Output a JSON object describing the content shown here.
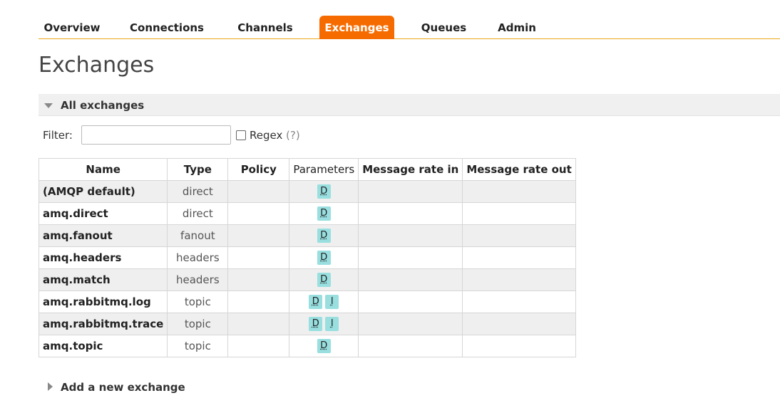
{
  "nav": {
    "tabs": [
      {
        "label": "Overview",
        "active": false
      },
      {
        "label": "Connections",
        "active": false
      },
      {
        "label": "Channels",
        "active": false
      },
      {
        "label": "Exchanges",
        "active": true
      },
      {
        "label": "Queues",
        "active": false
      },
      {
        "label": "Admin",
        "active": false
      }
    ],
    "accent_color": "#f66b00"
  },
  "page_title": "Exchanges",
  "section": {
    "title": "All exchanges"
  },
  "filter": {
    "label": "Filter:",
    "value": "",
    "regex_label": "Regex",
    "regex_checked": false,
    "regex_help": "(?)"
  },
  "table": {
    "headers": [
      "Name",
      "Type",
      "Policy",
      "Parameters",
      "Message rate in",
      "Message rate out"
    ],
    "rows": [
      {
        "name": "(AMQP default)",
        "type": "direct",
        "policy": "",
        "params": [
          "D"
        ],
        "rate_in": "",
        "rate_out": ""
      },
      {
        "name": "amq.direct",
        "type": "direct",
        "policy": "",
        "params": [
          "D"
        ],
        "rate_in": "",
        "rate_out": ""
      },
      {
        "name": "amq.fanout",
        "type": "fanout",
        "policy": "",
        "params": [
          "D"
        ],
        "rate_in": "",
        "rate_out": ""
      },
      {
        "name": "amq.headers",
        "type": "headers",
        "policy": "",
        "params": [
          "D"
        ],
        "rate_in": "",
        "rate_out": ""
      },
      {
        "name": "amq.match",
        "type": "headers",
        "policy": "",
        "params": [
          "D"
        ],
        "rate_in": "",
        "rate_out": ""
      },
      {
        "name": "amq.rabbitmq.log",
        "type": "topic",
        "policy": "",
        "params": [
          "D",
          "I"
        ],
        "rate_in": "",
        "rate_out": ""
      },
      {
        "name": "amq.rabbitmq.trace",
        "type": "topic",
        "policy": "",
        "params": [
          "D",
          "I"
        ],
        "rate_in": "",
        "rate_out": ""
      },
      {
        "name": "amq.topic",
        "type": "topic",
        "policy": "",
        "params": [
          "D"
        ],
        "rate_in": "",
        "rate_out": ""
      }
    ],
    "badge_color": "#99dfe0"
  },
  "add_section": {
    "title": "Add a new exchange"
  }
}
